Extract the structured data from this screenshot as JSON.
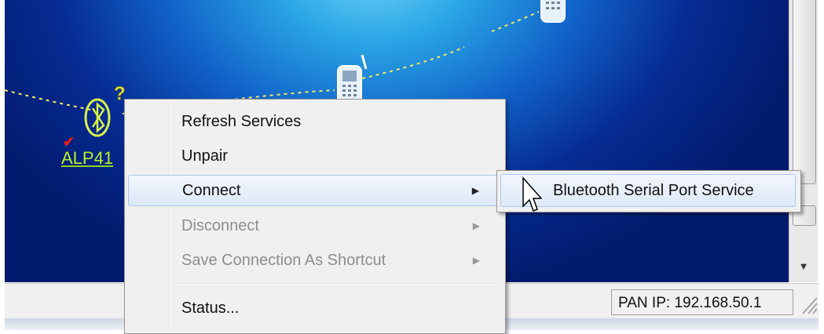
{
  "device": {
    "label": "ALP41",
    "paired_mark": "✔",
    "icon": "bluetooth-icon"
  },
  "context_menu": {
    "items": [
      {
        "label": "Refresh Services",
        "enabled": true,
        "has_submenu": false
      },
      {
        "label": "Unpair",
        "enabled": true,
        "has_submenu": false
      },
      {
        "label": "Connect",
        "enabled": true,
        "has_submenu": true,
        "highlighted": true
      },
      {
        "label": "Disconnect",
        "enabled": false,
        "has_submenu": true
      },
      {
        "label": "Save Connection As Shortcut",
        "enabled": false,
        "has_submenu": true
      },
      {
        "label": "Status...",
        "enabled": true,
        "has_submenu": false
      }
    ],
    "submenu_arrow": "▶"
  },
  "submenu": {
    "items": [
      {
        "label": "Bluetooth Serial Port Service",
        "highlighted": true
      }
    ]
  },
  "status_bar": {
    "pan_ip": "PAN IP: 192.168.50.1"
  },
  "scrollbar": {
    "down_arrow": "▼"
  },
  "colors": {
    "accent_highlight": "#a8c8ec",
    "device_label": "#b9f12d",
    "network_line": "#f5e96a"
  }
}
